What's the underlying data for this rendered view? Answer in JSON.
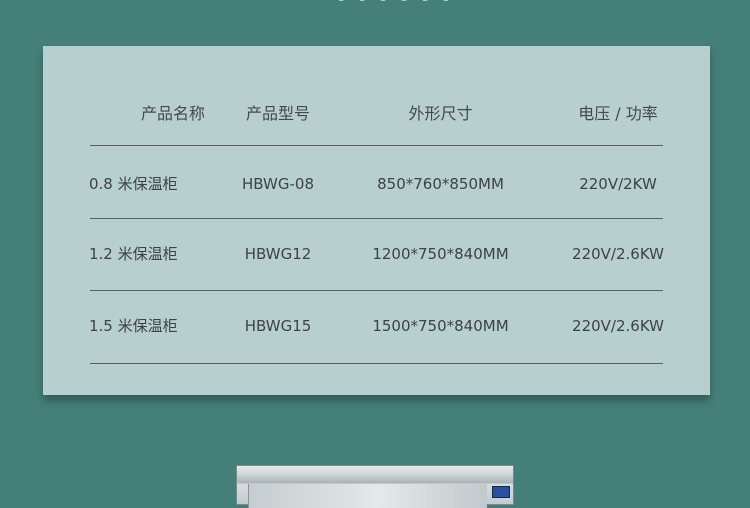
{
  "header": {
    "product_name": "产品名称",
    "product_model": "产品型号",
    "dimensions": "外形尺寸",
    "voltage_power": "电压 / 功率"
  },
  "rows": [
    {
      "name": "0.8 米保温柜",
      "model": "HBWG-08",
      "dimensions": "850*760*850MM",
      "voltage_power": "220V/2KW"
    },
    {
      "name": "1.2 米保温柜",
      "model": "HBWG12",
      "dimensions": "1200*750*840MM",
      "voltage_power": "220V/2.6KW"
    },
    {
      "name": "1.5 米保温柜",
      "model": "HBWG15",
      "dimensions": "1500*750*840MM",
      "voltage_power": "220V/2.6KW"
    }
  ],
  "colors": {
    "background": "#457f7a",
    "card": "#b8cfcf",
    "text": "#3f4543",
    "rule": "#59605f"
  }
}
